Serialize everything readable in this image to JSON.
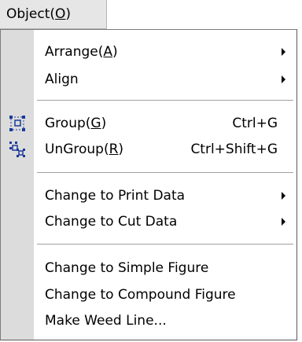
{
  "menubar": {
    "title_prefix": "Object(",
    "title_key": "O",
    "title_suffix": ")"
  },
  "menu": {
    "arrange": {
      "prefix": "Arrange(",
      "key": "A",
      "suffix": ")"
    },
    "align": {
      "label": "Align"
    },
    "group": {
      "prefix": "Group(",
      "key": "G",
      "suffix": ")",
      "shortcut": "Ctrl+G",
      "icon": "group-icon"
    },
    "ungroup": {
      "prefix": "UnGroup(",
      "key": "R",
      "suffix": ")",
      "shortcut": "Ctrl+Shift+G",
      "icon": "ungroup-icon"
    },
    "print": {
      "label": "Change to Print Data"
    },
    "cut": {
      "label": "Change to Cut Data"
    },
    "simple": {
      "label": "Change to Simple Figure"
    },
    "compound": {
      "label": "Change to Compound Figure"
    },
    "weed": {
      "label": "Make Weed Line..."
    }
  },
  "colors": {
    "icon_blue": "#1a3a9a",
    "gutter": "#dcdcdc",
    "menubar_highlight": "#e6e6e6"
  }
}
